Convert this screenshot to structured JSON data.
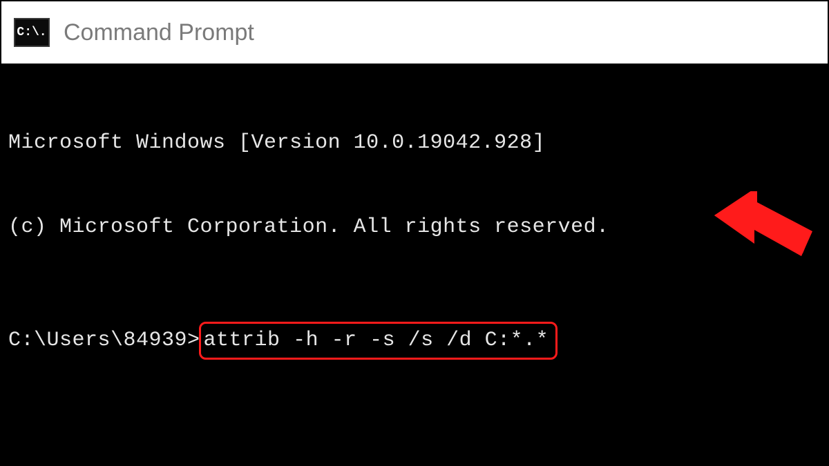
{
  "window": {
    "title": "Command Prompt",
    "icon_label": "C:\\."
  },
  "terminal": {
    "banner_line1": "Microsoft Windows [Version 10.0.19042.928]",
    "banner_line2": "(c) Microsoft Corporation. All rights reserved.",
    "prompt": "C:\\Users\\84939>",
    "command": "attrib -h -r -s /s /d C:*.*"
  },
  "annotation": {
    "highlight_color": "#ff1b1b",
    "arrow_color": "#ff1b1b"
  }
}
